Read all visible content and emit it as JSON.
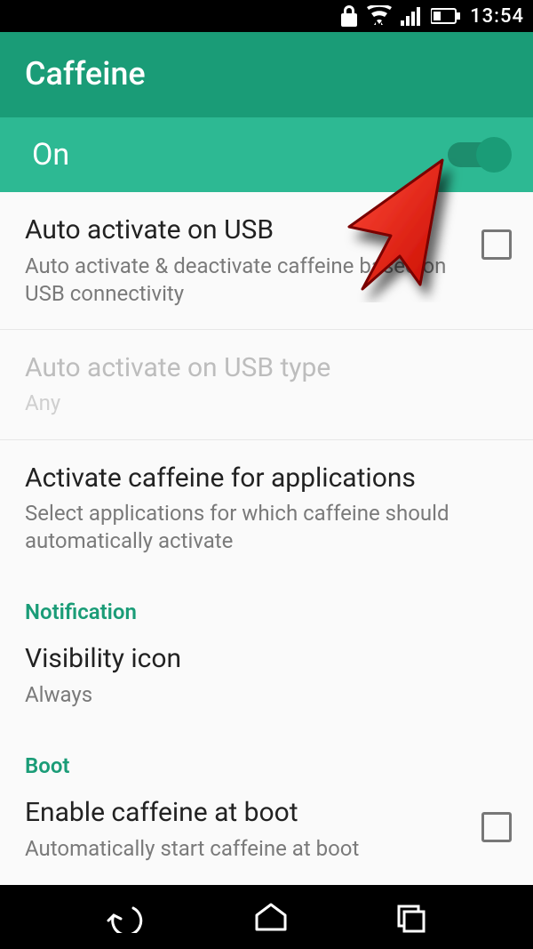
{
  "status": {
    "time": "13:54"
  },
  "appbar": {
    "title": "Caffeine"
  },
  "master": {
    "label": "On",
    "enabled": true
  },
  "items": {
    "usb": {
      "title": "Auto activate on USB",
      "sub": "Auto activate & deactivate caffeine based on USB connectivity"
    },
    "usbType": {
      "title": "Auto activate on USB type",
      "sub": "Any"
    },
    "apps": {
      "title": "Activate caffeine for applications",
      "sub": "Select applications for which caffeine should automatically activate"
    },
    "visibility": {
      "title": "Visibility icon",
      "sub": "Always"
    },
    "boot": {
      "title": "Enable caffeine at boot",
      "sub": "Automatically start caffeine at boot"
    }
  },
  "sections": {
    "notification": "Notification",
    "boot": "Boot"
  }
}
